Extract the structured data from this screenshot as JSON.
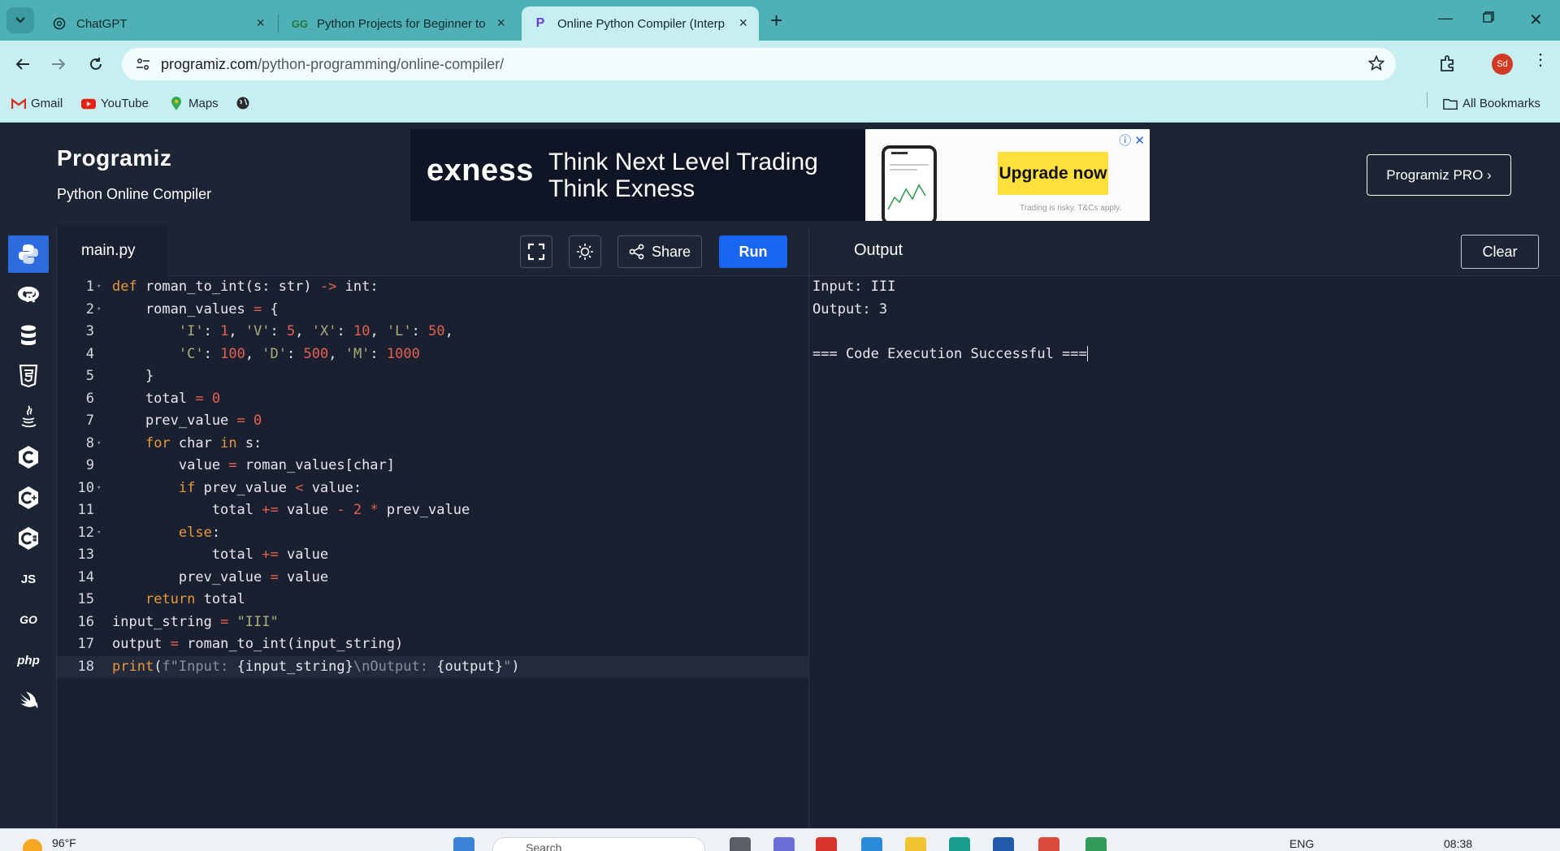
{
  "browser": {
    "tabs": [
      {
        "label": "ChatGPT",
        "icon": "chatgpt-icon"
      },
      {
        "label": "Python Projects for Beginner to",
        "icon": "geeksforgeeks-icon"
      },
      {
        "label": "Online Python Compiler (Interp",
        "icon": "programiz-icon"
      }
    ],
    "url_host": "programiz.com",
    "url_path": "/python-programming/online-compiler/",
    "profile_initials": "Sd",
    "bookmarks": [
      {
        "label": "Gmail",
        "icon": "gmail-icon"
      },
      {
        "label": "YouTube",
        "icon": "youtube-icon"
      },
      {
        "label": "Maps",
        "icon": "maps-icon"
      }
    ],
    "all_bookmarks": "All Bookmarks"
  },
  "header": {
    "logo": "Programiz",
    "subtitle": "Python Online Compiler",
    "pro_button": "Programiz PRO ›"
  },
  "ad": {
    "brand": "exness",
    "headline_1": "Think Next Level Trading",
    "headline_2": "Think Exness",
    "cta": "Upgrade now",
    "fine_print": "Trading is risky. T&Cs apply."
  },
  "editor": {
    "filename": "main.py",
    "share_label": "Share",
    "run_label": "Run"
  },
  "languages": [
    "python",
    "r",
    "sql",
    "html",
    "java",
    "c",
    "cpp",
    "csharp",
    "JS",
    "GO",
    "php",
    "swift"
  ],
  "output": {
    "title": "Output",
    "clear_label": "Clear",
    "lines": [
      "Input: III",
      "Output: 3",
      "",
      "=== Code Execution Successful ==="
    ]
  },
  "taskbar": {
    "temperature": "96°F",
    "search_placeholder": "Search",
    "language": "ENG",
    "time": "08:38"
  },
  "colors": {
    "accent": "#1966f0",
    "tab_strip": "#4fb0b6",
    "toolbar": "#c7eef0",
    "ide_bg": "#1a2030",
    "keyword": "#e79a3a",
    "string": "#a6b07a",
    "number": "#e4614f"
  }
}
